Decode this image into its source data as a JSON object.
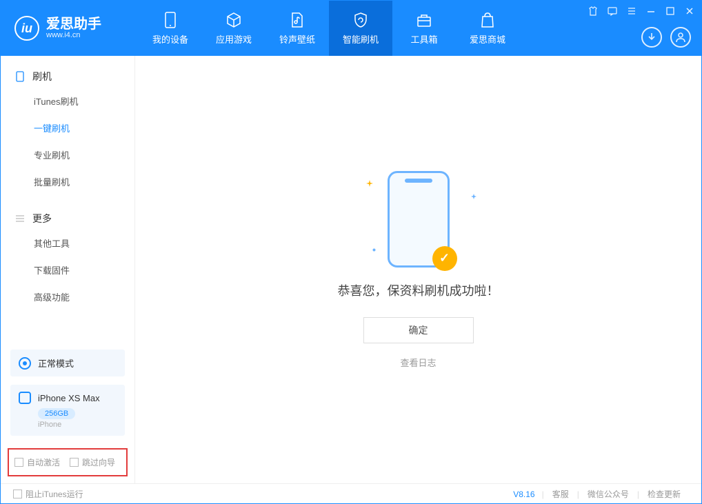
{
  "app": {
    "title": "爱思助手",
    "subtitle": "www.i4.cn"
  },
  "tabs": [
    {
      "label": "我的设备"
    },
    {
      "label": "应用游戏"
    },
    {
      "label": "铃声壁纸"
    },
    {
      "label": "智能刷机"
    },
    {
      "label": "工具箱"
    },
    {
      "label": "爱思商城"
    }
  ],
  "sidebar": {
    "section1": {
      "title": "刷机",
      "items": [
        "iTunes刷机",
        "一键刷机",
        "专业刷机",
        "批量刷机"
      ]
    },
    "section2": {
      "title": "更多",
      "items": [
        "其他工具",
        "下载固件",
        "高级功能"
      ]
    }
  },
  "mode": {
    "label": "正常模式"
  },
  "device": {
    "name": "iPhone XS Max",
    "capacity": "256GB",
    "type": "iPhone"
  },
  "options": {
    "opt1": "自动激活",
    "opt2": "跳过向导"
  },
  "main": {
    "message": "恭喜您，保资料刷机成功啦！",
    "ok": "确定",
    "log": "查看日志"
  },
  "footer": {
    "block_itunes": "阻止iTunes运行",
    "version": "V8.16",
    "link1": "客服",
    "link2": "微信公众号",
    "link3": "检查更新"
  }
}
